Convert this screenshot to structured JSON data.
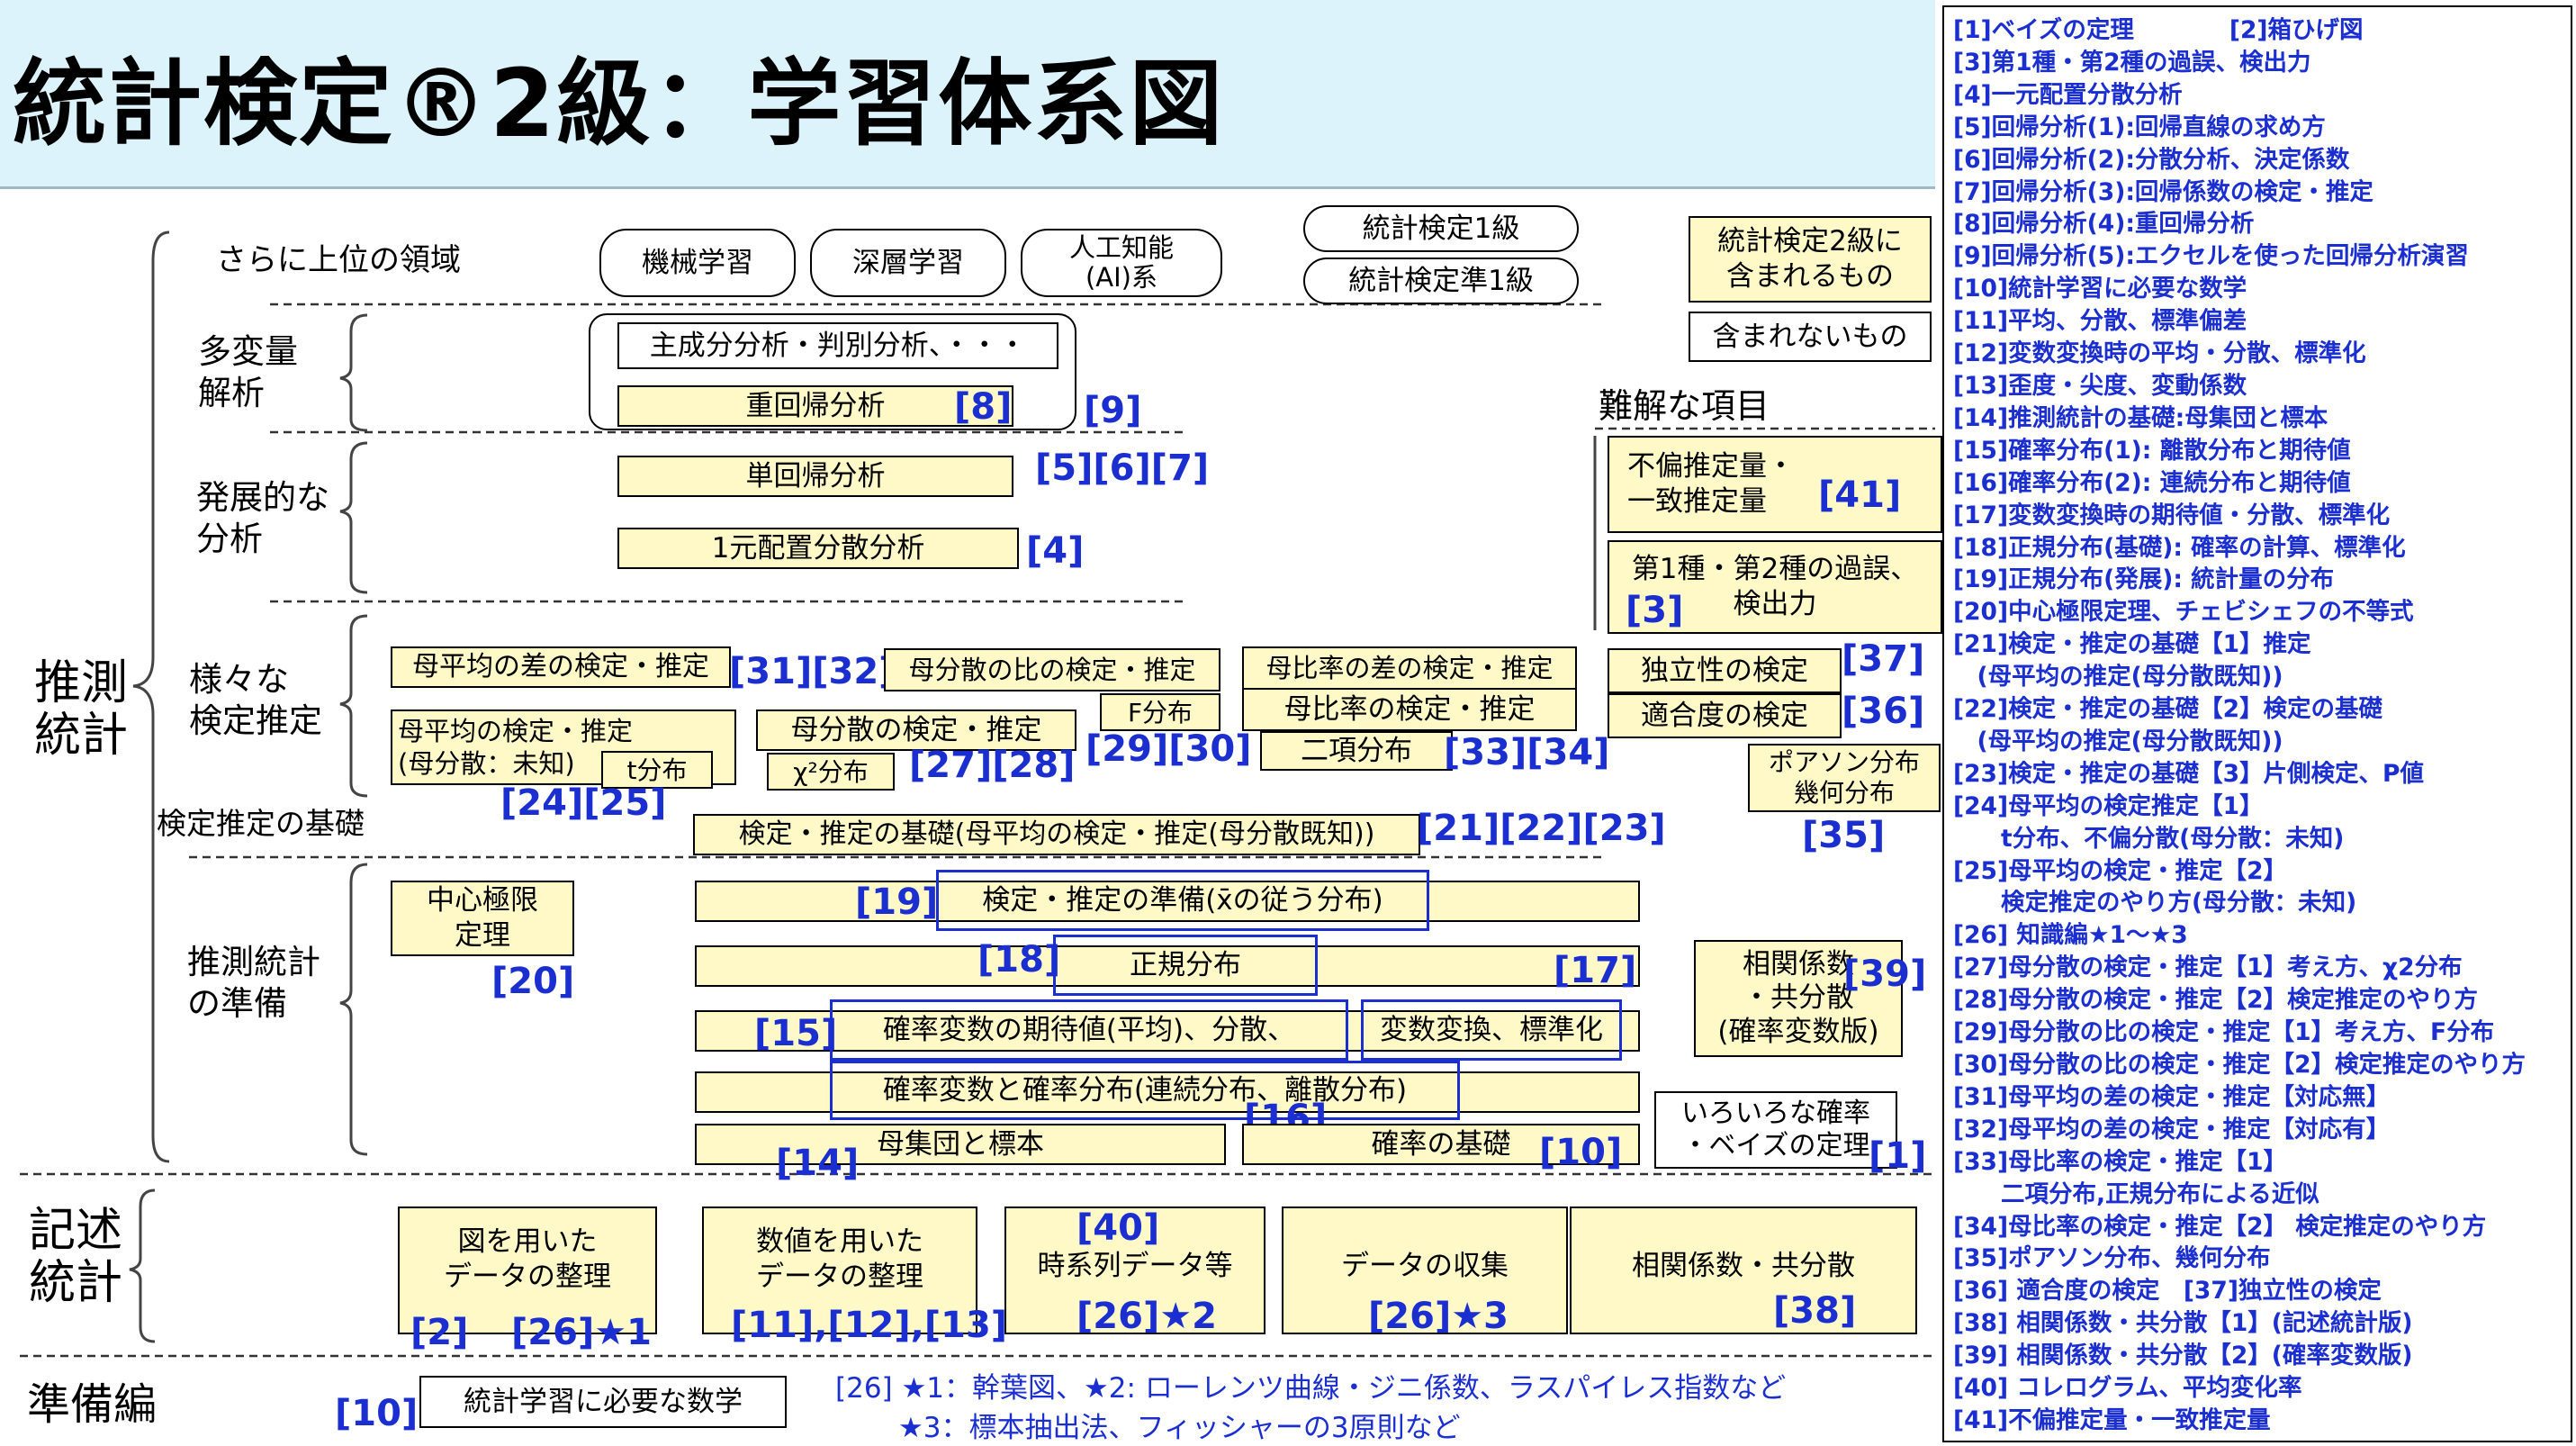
{
  "title": "統計検定®2級：学習体系図",
  "sections": {
    "higher": "さらに上位の領域",
    "multivariate": "多変量\n解析",
    "advanced": "発展的な\n分析",
    "various_tests": "様々な\n検定推定",
    "inferential": "推測\n統計",
    "test_basics": "検定推定の基礎",
    "inference_prep": "推測統計\nの準備",
    "descriptive": "記述\n統計",
    "preparation": "準備編",
    "difficult": "難解な項目"
  },
  "higher_boxes": {
    "ml": "機械学習",
    "dl": "深層学習",
    "ai": "人工知能\n(AI)系",
    "grade1": "統計検定1級",
    "pre1": "統計検定準1級"
  },
  "legend": {
    "included": "統計検定2級に\n含まれるもの",
    "not_included": "含まれないもの"
  },
  "boxes": {
    "pca": "主成分分析・判別分析、・・・",
    "multiple_reg": "重回帰分析",
    "simple_reg": "単回帰分析",
    "anova": "1元配置分散分析",
    "unbiased": "不偏推定量・\n一致推定量",
    "type_error": "第1種・第2種の過誤、\n検出力",
    "mean_diff": "母平均の差の検定・推定",
    "var_ratio": "母分散の比の検定・推定",
    "prop_diff": "母比率の差の検定・推定",
    "independence": "独立性の検定",
    "mean_test": "母平均の検定・推定\n(母分散：未知)",
    "t_dist": "t分布",
    "var_test": "母分散の検定・推定",
    "chi_dist": "χ²分布",
    "f_dist": "F分布",
    "prop_test": "母比率の検定・推定",
    "binomial": "二項分布",
    "goodness": "適合度の検定",
    "poisson": "ポアソン分布\n幾何分布",
    "test_basics": "検定・推定の基礎(母平均の検定・推定(母分散既知))",
    "clt": "中心極限\n定理",
    "prep_xbar": "検定・推定の準備(x̄の従う分布)",
    "normal": "正規分布",
    "expectation": "確率変数の期待値(平均)、分散、",
    "transform": "変数変換、標準化",
    "distribution": "確率変数と確率分布(連続分布、離散分布)",
    "population": "母集団と標本",
    "prob_basics": "確率の基礎",
    "correlation_rv": "相関係数\n・共分散\n(確率変数版)",
    "bayes": "いろいろな確率\n・ベイズの定理",
    "fig_data": "図を用いた\nデータの整理",
    "num_data": "数値を用いた\nデータの整理",
    "timeseries": "時系列データ等",
    "collection": "データの収集",
    "correlation": "相関係数・共分散",
    "math": "統計学習に必要な数学"
  },
  "refs": {
    "r8": "[8]",
    "r9": "[9]",
    "r567": "[5][6][7]",
    "r4": "[4]",
    "r41": "[41]",
    "r3": "[3]",
    "r3132": "[31][32]",
    "r37": "[37]",
    "r36": "[36]",
    "r2425": "[24][25]",
    "r2728": "[27][28]",
    "r2930": "[29][30]",
    "r3334": "[33][34]",
    "r212223": "[21][22][23]",
    "r35": "[35]",
    "r19": "[19]",
    "r20": "[20]",
    "r18": "[18]",
    "r17": "[17]",
    "r39": "[39]",
    "r15": "[15]",
    "r16": "[16]",
    "r14": "[14]",
    "r10a": "[10]",
    "r1": "[1]",
    "r2": "[2]",
    "r26s1": "[26]★1",
    "r111213": "[11],[12],[13]",
    "r40": "[40]",
    "r26s2": "[26]★2",
    "r26s3": "[26]★3",
    "r38": "[38]",
    "r10b": "[10]"
  },
  "footnote": {
    "line1": "[26] ★1：幹葉図、★2: ローレンツ曲線・ジニ係数、ラスパイレス指数など",
    "line2": "★3：標本抽出法、フィッシャーの3原則など"
  },
  "index": [
    "[1]ベイズの定理　　　　[2]箱ひげ図",
    "[3]第1種・第2種の過誤、検出力",
    "[4]一元配置分散分析",
    "[5]回帰分析(1):回帰直線の求め方",
    "[6]回帰分析(2):分散分析、決定係数",
    "[7]回帰分析(3):回帰係数の検定・推定",
    "[8]回帰分析(4):重回帰分析",
    "[9]回帰分析(5):エクセルを使った回帰分析演習",
    "[10]統計学習に必要な数学",
    "[11]平均、分散、標準偏差",
    "[12]変数変換時の平均・分散、標準化",
    "[13]歪度・尖度、変動係数",
    "[14]推測統計の基礎:母集団と標本",
    "[15]確率分布(1): 離散分布と期待値",
    "[16]確率分布(2): 連続分布と期待値",
    "[17]変数変換時の期待値・分散、標準化",
    "[18]正規分布(基礎): 確率の計算、標準化",
    "[19]正規分布(発展): 統計量の分布",
    "[20]中心極限定理、チェビシェフの不等式",
    "[21]検定・推定の基礎【1】推定",
    "　(母平均の推定(母分散既知))",
    "[22]検定・推定の基礎【2】検定の基礎",
    "　(母平均の推定(母分散既知))",
    "[23]検定・推定の基礎【3】片側検定、P値",
    "[24]母平均の検定推定【1】",
    "　　t分布、不偏分散(母分散：未知)",
    "[25]母平均の検定・推定【2】",
    "　　検定推定のやり方(母分散：未知)",
    "[26] 知識編★1～★3",
    "[27]母分散の検定・推定【1】考え方、χ2分布",
    "[28]母分散の検定・推定【2】検定推定のやり方",
    "[29]母分散の比の検定・推定【1】考え方、F分布",
    "[30]母分散の比の検定・推定【2】検定推定のやり方",
    "[31]母平均の差の検定・推定【対応無】",
    "[32]母平均の差の検定・推定【対応有】",
    "[33]母比率の検定・推定【1】",
    "　　二項分布,正規分布による近似",
    "[34]母比率の検定・推定【2】 検定推定のやり方",
    "[35]ポアソン分布、幾何分布",
    "[36] 適合度の検定　[37]独立性の検定",
    "[38] 相関係数・共分散【1】(記述統計版)",
    "[39] 相関係数・共分散【2】(確率変数版)",
    "[40] コレログラム、平均変化率",
    "[41]不偏推定量・一致推定量"
  ],
  "colors": {
    "header_bg": "#dcf3fb",
    "box_fill": "#fff9c8",
    "ref_blue": "#1b2fd1"
  }
}
